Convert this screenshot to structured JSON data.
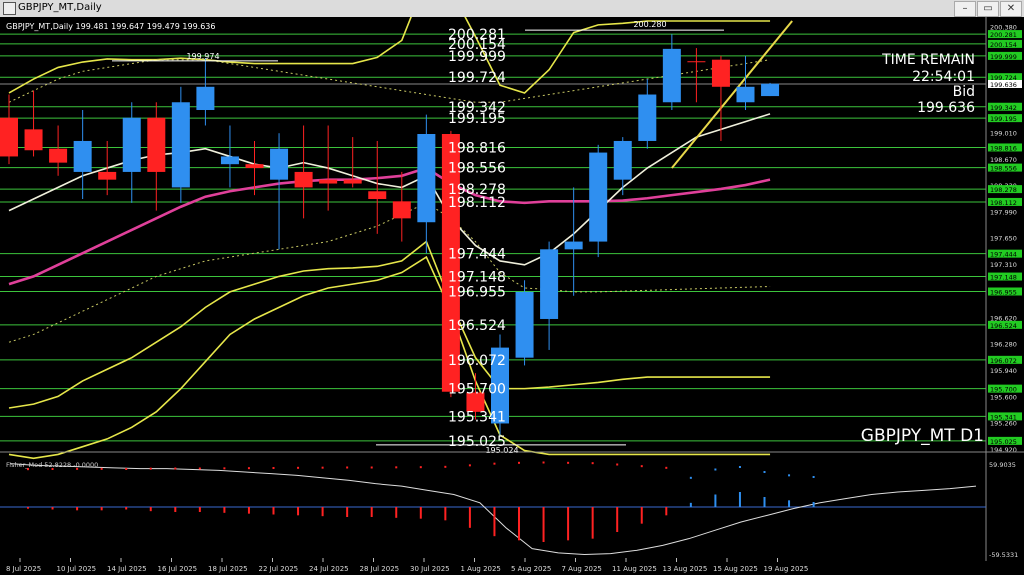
{
  "window": {
    "title": "GBPJPY_MT,Daily",
    "minimize_label": "–",
    "restore_label": "▭",
    "close_label": "✕"
  },
  "header": {
    "caption": "GBPJPY_MT,Daily  199.481 199.647 199.479 199.636"
  },
  "info": {
    "time_remain_label": "TIME REMAIN",
    "time_remain_value": "22:54:01",
    "bid_label": "Bid",
    "bid_value": "199.636",
    "symbol_watermark": "GBPJPY_MT D1"
  },
  "colors": {
    "bull": "#2f8ff0",
    "bear": "#ff2222",
    "level_line": "#3cc43c",
    "price_box": "#22cc22",
    "bb_outer": "#e6e64a",
    "ma_fast": "#f0f0dc",
    "ma_slow": "#e0409a",
    "trend": "#e8d84a"
  },
  "chart_data": {
    "type": "candlestick",
    "y_range": [
      194.92,
      200.45
    ],
    "price_ticks": [
      "200.380",
      "200.020",
      "199.690",
      "199.350",
      "199.010",
      "198.670",
      "198.330",
      "197.990",
      "197.650",
      "197.310",
      "196.970",
      "196.620",
      "196.280",
      "195.940",
      "195.600",
      "195.260",
      "194.920"
    ],
    "x_labels": [
      "8 Jul 2025",
      "10 Jul 2025",
      "14 Jul 2025",
      "16 Jul 2025",
      "18 Jul 2025",
      "22 Jul 2025",
      "24 Jul 2025",
      "28 Jul 2025",
      "30 Jul 2025",
      "1 Aug 2025",
      "5 Aug 2025",
      "7 Aug 2025",
      "11 Aug 2025",
      "13 Aug 2025",
      "15 Aug 2025",
      "19 Aug 2025"
    ],
    "candles": [
      {
        "o": 199.2,
        "h": 199.5,
        "l": 198.6,
        "c": 198.7
      },
      {
        "o": 199.05,
        "h": 199.55,
        "l": 198.7,
        "c": 198.78
      },
      {
        "o": 198.8,
        "h": 199.1,
        "l": 198.45,
        "c": 198.62
      },
      {
        "o": 198.5,
        "h": 199.3,
        "l": 198.15,
        "c": 198.9
      },
      {
        "o": 198.5,
        "h": 198.9,
        "l": 198.2,
        "c": 198.4
      },
      {
        "o": 198.5,
        "h": 199.4,
        "l": 198.1,
        "c": 199.2
      },
      {
        "o": 199.2,
        "h": 199.4,
        "l": 198.0,
        "c": 198.5
      },
      {
        "o": 198.3,
        "h": 199.6,
        "l": 198.1,
        "c": 199.4
      },
      {
        "o": 199.3,
        "h": 199.97,
        "l": 199.1,
        "c": 199.6
      },
      {
        "o": 198.6,
        "h": 199.1,
        "l": 198.3,
        "c": 198.7
      },
      {
        "o": 198.6,
        "h": 198.9,
        "l": 198.2,
        "c": 198.55
      },
      {
        "o": 198.4,
        "h": 199.0,
        "l": 197.5,
        "c": 198.8
      },
      {
        "o": 198.5,
        "h": 199.1,
        "l": 197.9,
        "c": 198.3
      },
      {
        "o": 198.4,
        "h": 199.1,
        "l": 198.0,
        "c": 198.35
      },
      {
        "o": 198.4,
        "h": 198.95,
        "l": 198.3,
        "c": 198.35
      },
      {
        "o": 198.25,
        "h": 198.9,
        "l": 197.7,
        "c": 198.15
      },
      {
        "o": 198.12,
        "h": 198.5,
        "l": 197.6,
        "c": 197.9
      },
      {
        "o": 197.85,
        "h": 199.24,
        "l": 197.45,
        "c": 198.99
      },
      {
        "o": 198.99,
        "h": 199.03,
        "l": 195.59,
        "c": 195.66
      },
      {
        "o": 195.65,
        "h": 195.9,
        "l": 195.3,
        "c": 195.4
      },
      {
        "o": 195.25,
        "h": 196.4,
        "l": 195.1,
        "c": 196.23
      },
      {
        "o": 196.1,
        "h": 197.1,
        "l": 196.0,
        "c": 196.95
      },
      {
        "o": 196.6,
        "h": 197.6,
        "l": 196.2,
        "c": 197.5
      },
      {
        "o": 197.5,
        "h": 198.3,
        "l": 196.9,
        "c": 197.6
      },
      {
        "o": 197.6,
        "h": 198.85,
        "l": 197.4,
        "c": 198.75
      },
      {
        "o": 198.4,
        "h": 198.95,
        "l": 198.2,
        "c": 198.9
      },
      {
        "o": 198.9,
        "h": 199.7,
        "l": 198.8,
        "c": 199.5
      },
      {
        "o": 199.4,
        "h": 200.28,
        "l": 199.3,
        "c": 200.09
      },
      {
        "o": 199.93,
        "h": 200.1,
        "l": 199.4,
        "c": 199.92
      },
      {
        "o": 199.95,
        "h": 200.0,
        "l": 198.9,
        "c": 199.6
      },
      {
        "o": 199.4,
        "h": 200.0,
        "l": 199.3,
        "c": 199.6
      },
      {
        "o": 199.48,
        "h": 199.65,
        "l": 199.48,
        "c": 199.64
      }
    ],
    "hi_marker": "200.280",
    "lo_marker": "195.024",
    "hi_marker_left": "199.974",
    "levels": [
      {
        "price": 200.281,
        "label": "200.281",
        "box": "200.281"
      },
      {
        "price": 200.154,
        "label": "200.154",
        "box": "200.154"
      },
      {
        "price": 199.999,
        "label": "199.999",
        "box": "199.999"
      },
      {
        "price": 199.724,
        "label": "199.724",
        "box": "199.724"
      },
      {
        "price": 199.342,
        "label": "199.342",
        "box": "199.342"
      },
      {
        "price": 199.195,
        "label": "199.195",
        "box": "199.195"
      },
      {
        "price": 198.816,
        "label": "198.816",
        "box": "198.816"
      },
      {
        "price": 198.556,
        "label": "198.556",
        "box": "198.556"
      },
      {
        "price": 198.278,
        "label": "198.278",
        "box": "198.278"
      },
      {
        "price": 198.112,
        "label": "198.112",
        "box": "198.112"
      },
      {
        "price": 197.444,
        "label": "197.444",
        "box": "197.444"
      },
      {
        "price": 197.148,
        "label": "197.148",
        "box": "197.148"
      },
      {
        "price": 196.955,
        "label": "196.955",
        "box": "196.955"
      },
      {
        "price": 196.524,
        "label": "196.524",
        "box": "196.524"
      },
      {
        "price": 196.072,
        "label": "196.072",
        "box": "196.072"
      },
      {
        "price": 195.7,
        "label": "195.700",
        "box": "195.700"
      },
      {
        "price": 195.341,
        "label": "195.341",
        "box": "195.341"
      },
      {
        "price": 195.025,
        "label": "195.025",
        "box": "195.025"
      }
    ],
    "current_price": {
      "price": 199.636,
      "label": "199.636"
    },
    "ma_fast": [
      198.0,
      198.15,
      198.3,
      198.45,
      198.55,
      198.65,
      198.72,
      198.75,
      198.8,
      198.7,
      198.6,
      198.55,
      198.62,
      198.55,
      198.45,
      198.35,
      198.3,
      198.45,
      197.9,
      197.55,
      197.35,
      197.3,
      197.45,
      197.7,
      198.0,
      198.3,
      198.55,
      198.75,
      198.95,
      199.05,
      199.15,
      199.25
    ],
    "ma_slow": [
      197.05,
      197.15,
      197.3,
      197.45,
      197.6,
      197.75,
      197.9,
      198.05,
      198.18,
      198.25,
      198.3,
      198.35,
      198.38,
      198.4,
      198.4,
      198.42,
      198.45,
      198.55,
      198.35,
      198.2,
      198.12,
      198.1,
      198.12,
      198.12,
      198.12,
      198.13,
      198.16,
      198.2,
      198.24,
      198.28,
      198.33,
      198.4
    ],
    "mid_dotted": [
      196.3,
      196.4,
      196.55,
      196.7,
      196.85,
      197.0,
      197.15,
      197.25,
      197.35,
      197.4,
      197.45,
      197.5,
      197.55,
      197.6,
      197.7,
      197.8,
      197.95,
      198.1,
      197.9,
      197.6,
      197.2,
      197.0,
      196.98,
      196.95,
      196.95,
      196.96,
      196.97,
      196.98,
      196.99,
      197.0,
      197.01,
      197.02
    ],
    "upper_dotted": [
      199.4,
      199.55,
      199.7,
      199.8,
      199.85,
      199.9,
      199.95,
      199.95,
      199.95,
      199.9,
      199.85,
      199.8,
      199.75,
      199.7,
      199.65,
      199.6,
      199.55,
      199.5,
      199.45,
      199.4,
      199.4,
      199.45,
      199.5,
      199.55,
      199.6,
      199.65,
      199.7,
      199.75,
      199.8,
      199.85,
      199.9,
      199.95
    ],
    "bb_upper": [
      199.52,
      199.7,
      199.85,
      199.92,
      199.96,
      199.95,
      199.95,
      199.97,
      199.95,
      199.92,
      199.9,
      199.9,
      199.9,
      199.9,
      199.9,
      199.98,
      200.2,
      201.0,
      200.85,
      200.25,
      199.62,
      199.52,
      199.82,
      200.3,
      200.4,
      200.42,
      200.45,
      200.45,
      200.45,
      200.45,
      200.45,
      200.45
    ],
    "bb_lower": [
      195.45,
      195.5,
      195.6,
      195.8,
      195.95,
      196.1,
      196.3,
      196.5,
      196.75,
      196.95,
      197.05,
      197.15,
      197.22,
      197.25,
      197.26,
      197.28,
      197.35,
      197.6,
      196.8,
      196.1,
      195.7,
      195.7,
      195.72,
      195.75,
      195.78,
      195.82,
      195.85,
      195.85,
      195.85,
      195.85,
      195.85,
      195.85
    ],
    "bb_lower2": [
      194.85,
      194.8,
      194.85,
      194.95,
      195.05,
      195.2,
      195.4,
      195.7,
      196.05,
      196.4,
      196.6,
      196.75,
      196.9,
      197.0,
      197.05,
      197.1,
      197.2,
      197.4,
      196.7,
      195.8,
      195.1,
      194.9,
      194.85,
      194.85,
      194.85,
      194.85,
      194.85,
      194.85,
      194.85,
      194.85,
      194.85,
      194.85
    ],
    "trend_line": [
      {
        "i": 27,
        "p": 198.55
      },
      {
        "i": 31.9,
        "p": 200.45
      }
    ],
    "oscillator": {
      "label": "Fisher_Mod 52.8228  -0.0000",
      "top_label": "59.9035",
      "bottom_label": "-59.5331",
      "signal": [
        52,
        50,
        49,
        48,
        47,
        46,
        46,
        45,
        44,
        42,
        40,
        38,
        35,
        32,
        28,
        25,
        20,
        15,
        5,
        -25,
        -50,
        -55,
        -57,
        -56,
        -52,
        -46,
        -38,
        -28,
        -18,
        -10,
        -2,
        5,
        10,
        15,
        18,
        20,
        22,
        25
      ],
      "bars": [
        -2,
        -3,
        -4,
        -4,
        -3,
        -5,
        -6,
        -6,
        -7,
        -8,
        -9,
        -10,
        -11,
        -12,
        -12,
        -13,
        -14,
        -16,
        -25,
        -35,
        -40,
        -42,
        -40,
        -38,
        -30,
        -20,
        -10,
        5,
        15,
        18,
        12,
        8,
        6
      ]
    }
  }
}
